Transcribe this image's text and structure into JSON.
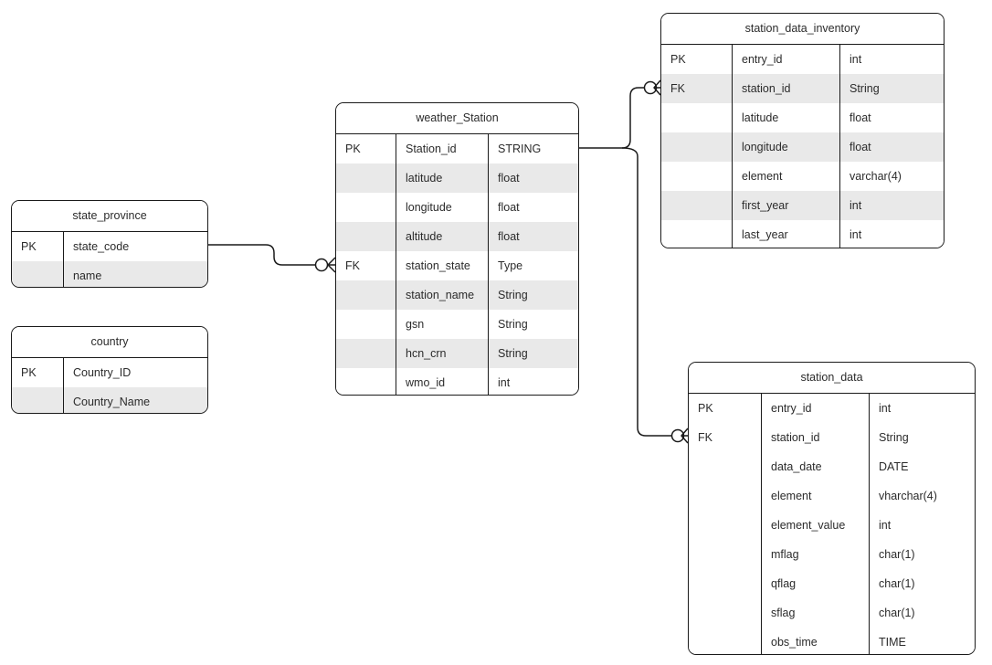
{
  "diagram": {
    "type": "entity-relationship-diagram",
    "background": "#ffffff",
    "line_color": "#1a1a1a",
    "row_alt_color": "#e9e9e9",
    "text_color": "#2b2b2b"
  },
  "entities": [
    {
      "id": "state_province",
      "title": "state_province",
      "columns": [
        {
          "key": "PK",
          "name": "state_code",
          "type": "",
          "shaded": false
        },
        {
          "key": "",
          "name": "name",
          "type": "",
          "shaded": true
        }
      ]
    },
    {
      "id": "country",
      "title": "country",
      "columns": [
        {
          "key": "PK",
          "name": "Country_ID",
          "type": "",
          "shaded": false
        },
        {
          "key": "",
          "name": "Country_Name",
          "type": "",
          "shaded": true
        }
      ]
    },
    {
      "id": "weather_Station",
      "title": "weather_Station",
      "columns": [
        {
          "key": "PK",
          "name": "Station_id",
          "type": "STRING",
          "shaded": false
        },
        {
          "key": "",
          "name": "latitude",
          "type": "float",
          "shaded": true
        },
        {
          "key": "",
          "name": "longitude",
          "type": "float",
          "shaded": false
        },
        {
          "key": "",
          "name": "altitude",
          "type": "float",
          "shaded": true
        },
        {
          "key": "FK",
          "name": "station_state",
          "type": "Type",
          "shaded": false
        },
        {
          "key": "",
          "name": "station_name",
          "type": "String",
          "shaded": true
        },
        {
          "key": "",
          "name": "gsn",
          "type": "String",
          "shaded": false
        },
        {
          "key": "",
          "name": "hcn_crn",
          "type": "String",
          "shaded": true
        },
        {
          "key": "",
          "name": "wmo_id",
          "type": "int",
          "shaded": false
        }
      ]
    },
    {
      "id": "station_data_inventory",
      "title": "station_data_inventory",
      "columns": [
        {
          "key": "PK",
          "name": "entry_id",
          "type": "int",
          "shaded": false
        },
        {
          "key": "FK",
          "name": "station_id",
          "type": "String",
          "shaded": true
        },
        {
          "key": "",
          "name": "latitude",
          "type": "float",
          "shaded": false
        },
        {
          "key": "",
          "name": "longitude",
          "type": "float",
          "shaded": true
        },
        {
          "key": "",
          "name": "element",
          "type": "varchar(4)",
          "shaded": false
        },
        {
          "key": "",
          "name": "first_year",
          "type": "int",
          "shaded": true
        },
        {
          "key": "",
          "name": "last_year",
          "type": "int",
          "shaded": false
        }
      ]
    },
    {
      "id": "station_data",
      "title": "station_data",
      "columns": [
        {
          "key": "PK",
          "name": "entry_id",
          "type": "int",
          "shaded": false
        },
        {
          "key": "FK",
          "name": "station_id",
          "type": "String",
          "shaded": false
        },
        {
          "key": "",
          "name": "data_date",
          "type": "DATE",
          "shaded": false
        },
        {
          "key": "",
          "name": "element",
          "type": "vharchar(4)",
          "shaded": false
        },
        {
          "key": "",
          "name": "element_value",
          "type": "int",
          "shaded": false
        },
        {
          "key": "",
          "name": "mflag",
          "type": "char(1)",
          "shaded": false
        },
        {
          "key": "",
          "name": "qflag",
          "type": "char(1)",
          "shaded": false
        },
        {
          "key": "",
          "name": "sflag",
          "type": "char(1)",
          "shaded": false
        },
        {
          "key": "",
          "name": "obs_time",
          "type": "TIME",
          "shaded": false
        }
      ]
    }
  ],
  "relationships": [
    {
      "id": "state_province-to-weather_Station",
      "from": "state_province.state_code",
      "to": "weather_Station.station_state",
      "from_notation": "one",
      "to_notation": "zero-or-many"
    },
    {
      "id": "weather_Station-to-station_data_inventory",
      "from": "weather_Station.Station_id",
      "to": "station_data_inventory.station_id",
      "from_notation": "one",
      "to_notation": "zero-or-many"
    },
    {
      "id": "weather_Station-to-station_data",
      "from": "weather_Station.Station_id",
      "to": "station_data.station_id",
      "from_notation": "one",
      "to_notation": "zero-or-many"
    }
  ]
}
